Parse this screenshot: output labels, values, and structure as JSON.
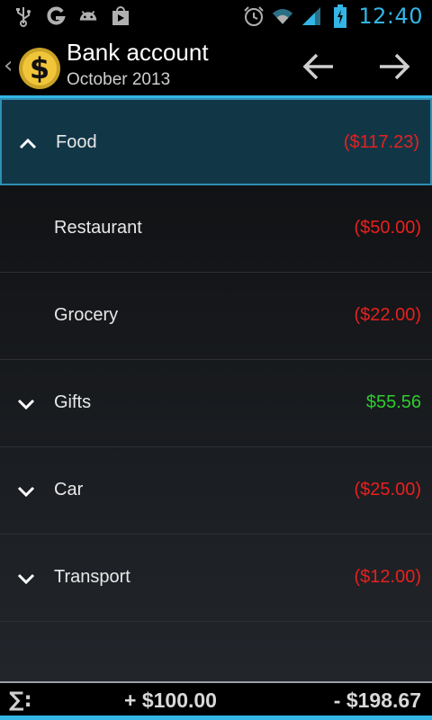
{
  "status_bar": {
    "time": "12:40",
    "left_icons": [
      "usb-icon",
      "g-icon",
      "android-icon",
      "play-store-icon"
    ],
    "right_icons": [
      "alarm-icon",
      "wifi-icon",
      "signal-icon",
      "battery-charging-icon"
    ],
    "accent": "#33b5e5"
  },
  "action_bar": {
    "title": "Bank account",
    "subtitle": "October 2013",
    "prev_icon": "arrow-left-icon",
    "next_icon": "arrow-right-icon"
  },
  "categories": [
    {
      "label": "Food",
      "amount": "($117.23)",
      "expanded": true,
      "selected": true,
      "sign": "negative"
    },
    {
      "label": "Restaurant",
      "amount": "($50.00)",
      "child": true,
      "sign": "negative"
    },
    {
      "label": "Grocery",
      "amount": "($22.00)",
      "child": true,
      "sign": "negative"
    },
    {
      "label": "Gifts",
      "amount": "$55.56",
      "expanded": false,
      "sign": "positive"
    },
    {
      "label": "Car",
      "amount": "($25.00)",
      "expanded": false,
      "sign": "negative"
    },
    {
      "label": "Transport",
      "amount": "($12.00)",
      "expanded": false,
      "sign": "negative"
    }
  ],
  "footer": {
    "sigma": "∑:",
    "income": "+ $100.00",
    "expense": "- $198.67"
  },
  "colors": {
    "negative": "#e8201f",
    "positive": "#2fcc2f",
    "selected_bg": "#113747"
  }
}
